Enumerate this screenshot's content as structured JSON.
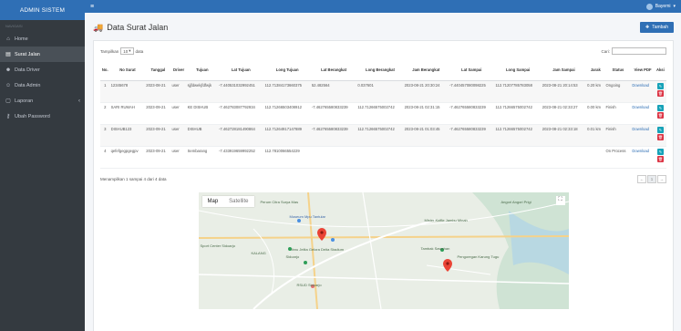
{
  "app": {
    "brand": "ADMIN SISTEM",
    "user_name": "Bayemi"
  },
  "sidebar": {
    "head": "NAVIGASI",
    "items": [
      {
        "label": "Home",
        "icon": "home-icon"
      },
      {
        "label": "Surat Jalan",
        "icon": "truck-icon",
        "active": true
      },
      {
        "label": "Data Driver",
        "icon": "users-icon"
      },
      {
        "label": "Data Admin",
        "icon": "user-icon"
      },
      {
        "label": "Laporan",
        "icon": "file-icon"
      },
      {
        "label": "Ubah Password",
        "icon": "key-icon"
      }
    ]
  },
  "page": {
    "title": "Data Surat Jalan",
    "add_label": "Tambah"
  },
  "table_tools": {
    "show_prefix": "Tampilkan",
    "show_value": "10",
    "show_suffix": "data",
    "search_label": "Cari:"
  },
  "table": {
    "headers": [
      "No.",
      "No Surat",
      "Tanggal",
      "Driver",
      "Tujuan",
      "Lat Tujuan",
      "Long Tujuan",
      "Lat Berangkat",
      "Long Berangkat",
      "Jam Berangkat",
      "Lat Sampai",
      "Long Sampai",
      "Jam Sampai",
      "Jarak",
      "Status",
      "View PDF",
      "Aksi"
    ],
    "rows": [
      [
        "1",
        "12345678",
        "2023-08-21",
        "user",
        "sjjfdwekjfdfwjk",
        "-7.440531032992451",
        "112.71384173660375",
        "52.482564",
        "0.037601",
        "2023-08-21 20:30:24",
        "-7.440457080098225",
        "112.71207785783058",
        "2023-08-21 20:14:53",
        "0.20 km",
        "Ongoing",
        "Download"
      ],
      [
        "2",
        "SARI RUMAH",
        "2023-09-21",
        "user",
        "KE DISHUB",
        "-7.462783087792934",
        "112.71266503408912",
        "-7.462765580833239",
        "112.71266575002742",
        "2023-08-21 02:31:15",
        "-7.462765580833239",
        "112.71266575002742",
        "2023-08-21 02:33:27",
        "0.00 km",
        "Finish",
        "Download"
      ],
      [
        "3",
        "DISHUB123",
        "2023-09-21",
        "user",
        "DISHUB",
        "-7.462728181490864",
        "112.71264917147889",
        "-7.462765580833239",
        "112.71266575002742",
        "2023-08-21 01:03:45",
        "-7.462765580833239",
        "112.71266575002742",
        "2023-08-21 02:33:18",
        "0.01 km",
        "Finish",
        "Download"
      ],
      [
        "4",
        "qefefgegpgegpv",
        "2023-09-21",
        "user",
        "Sembarang",
        "-7.433919659992252",
        "112.7810066554229",
        "",
        "",
        "",
        "",
        "",
        "",
        "",
        "On Process",
        "Download"
      ]
    ]
  },
  "footer": {
    "info": "Menampilkan 1 sampai 4 dari 4 data",
    "prev": "←",
    "page": "1",
    "next": "→"
  },
  "map": {
    "tab_map": "Map",
    "tab_satellite": "Satellite",
    "labels": [
      "Perum Citra Surya Mas",
      "Museum Mpu Tantular",
      "Ibnu Jelita Gelora Delta Stadium",
      "Sidoarjo",
      "RSUD Sidoarjo",
      "Sport Center Sidoarjo",
      "KALANG",
      "Mister Koffie Jambu Minah",
      "Tambak Sawahan",
      "Pengoregan Karung Tugu",
      "Angori Angori Prigi"
    ]
  },
  "colors": {
    "brand": "#2f6fb5",
    "sidebar": "#343a40",
    "edit": "#17a2b8",
    "delete": "#dc3545"
  }
}
